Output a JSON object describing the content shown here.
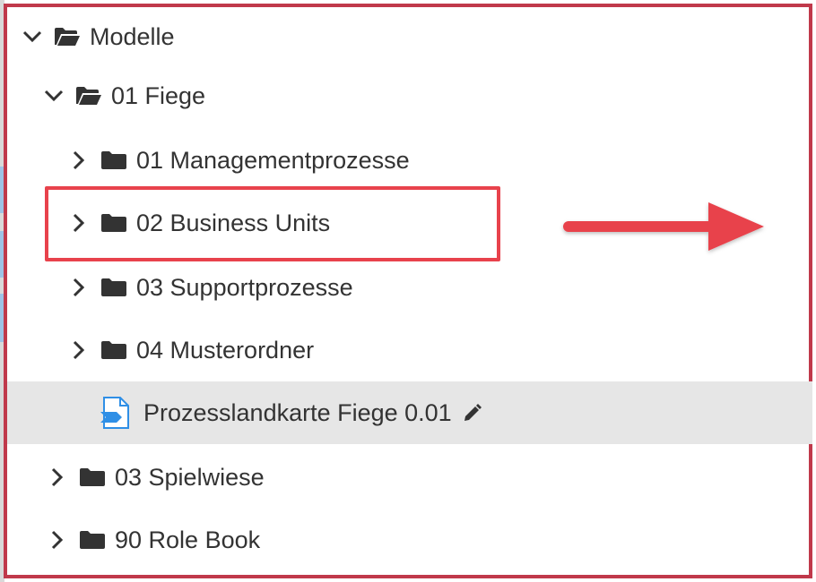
{
  "tree": {
    "items": [
      {
        "label": "Modelle",
        "icon": "folder-open-icon",
        "chevron": "chevron-down-icon",
        "level": 0,
        "expanded": true
      },
      {
        "label": "01 Fiege",
        "icon": "folder-open-icon",
        "chevron": "chevron-down-icon",
        "level": 1,
        "expanded": true
      },
      {
        "label": "01 Managementprozesse",
        "icon": "folder-icon",
        "chevron": "chevron-right-icon",
        "level": 2,
        "expanded": false
      },
      {
        "label": "02 Business Units",
        "icon": "folder-icon",
        "chevron": "chevron-right-icon",
        "level": 2,
        "expanded": false,
        "highlighted": true
      },
      {
        "label": "03 Supportprozesse",
        "icon": "folder-icon",
        "chevron": "chevron-right-icon",
        "level": 2,
        "expanded": false
      },
      {
        "label": "04 Musterordner",
        "icon": "folder-icon",
        "chevron": "chevron-right-icon",
        "level": 2,
        "expanded": false
      },
      {
        "label": "Prozesslandkarte Fiege 0.01",
        "icon": "process-map-icon",
        "level": 3,
        "selected": true,
        "edit_icon": "pencil-icon"
      },
      {
        "label": "03 Spielwiese",
        "icon": "folder-icon",
        "chevron": "chevron-right-icon",
        "level": 1,
        "expanded": false
      },
      {
        "label": "90 Role Book",
        "icon": "folder-icon",
        "chevron": "chevron-right-icon",
        "level": 1,
        "expanded": false
      }
    ]
  },
  "colors": {
    "frame": "#c0394b",
    "highlight_box": "#e8424c",
    "arrow": "#e8424c",
    "selected_row_bg": "#e6e6e6",
    "icon_dark": "#333333",
    "file_icon_blue": "#2f8fe6"
  }
}
